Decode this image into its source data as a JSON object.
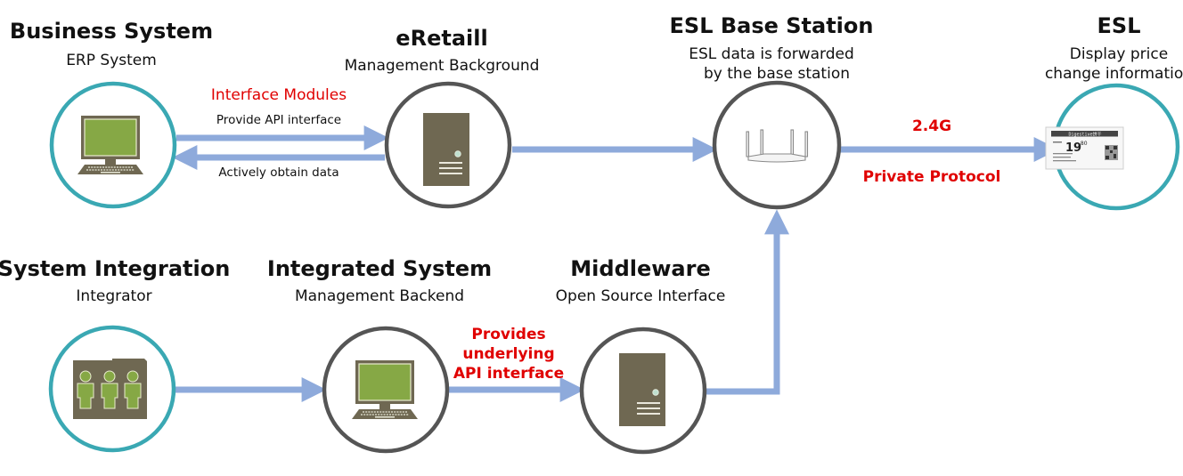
{
  "colors": {
    "teal": "#3aa8b3",
    "gray": "#555555",
    "arrow": "#8eaadb",
    "icon_dark": "#6f6852",
    "icon_green": "#86a845",
    "red_text": "#e00000"
  },
  "nodes": {
    "business_system": {
      "title": "Business System",
      "subtitle": "ERP System",
      "icon": "desktop-computer-icon"
    },
    "eretail": {
      "title": "eRetaill",
      "subtitle": "Management Background",
      "icon": "server-tower-icon"
    },
    "esl_base_station": {
      "title": "ESL Base Station",
      "subtitle_line1": "ESL data is forwarded",
      "subtitle_line2": "by the base station",
      "icon": "wireless-router-icon"
    },
    "esl": {
      "title": "ESL",
      "subtitle_line1": "Display price",
      "subtitle_line2": "change information",
      "icon": "electronic-shelf-label-icon",
      "label_header": "Digestive饼干",
      "label_price_main": "19",
      "label_price_cents": ".80"
    },
    "system_integration": {
      "title": "System Integration",
      "subtitle": "Integrator",
      "icon": "people-folder-icon"
    },
    "integrated_system": {
      "title": "Integrated System",
      "subtitle": "Management Backend",
      "icon": "desktop-computer-icon"
    },
    "middleware": {
      "title": "Middleware",
      "subtitle": "Open Source Interface",
      "icon": "server-tower-icon"
    }
  },
  "edges": {
    "interface_modules": {
      "heading": "Interface Modules",
      "forward": "Provide API interface",
      "backward": "Actively obtain data"
    },
    "wireless": {
      "top": "2.4G",
      "bottom": "Private Protocol"
    },
    "underlying_api": {
      "line1": "Provides",
      "line2": "underlying",
      "line3": "API interface"
    }
  }
}
